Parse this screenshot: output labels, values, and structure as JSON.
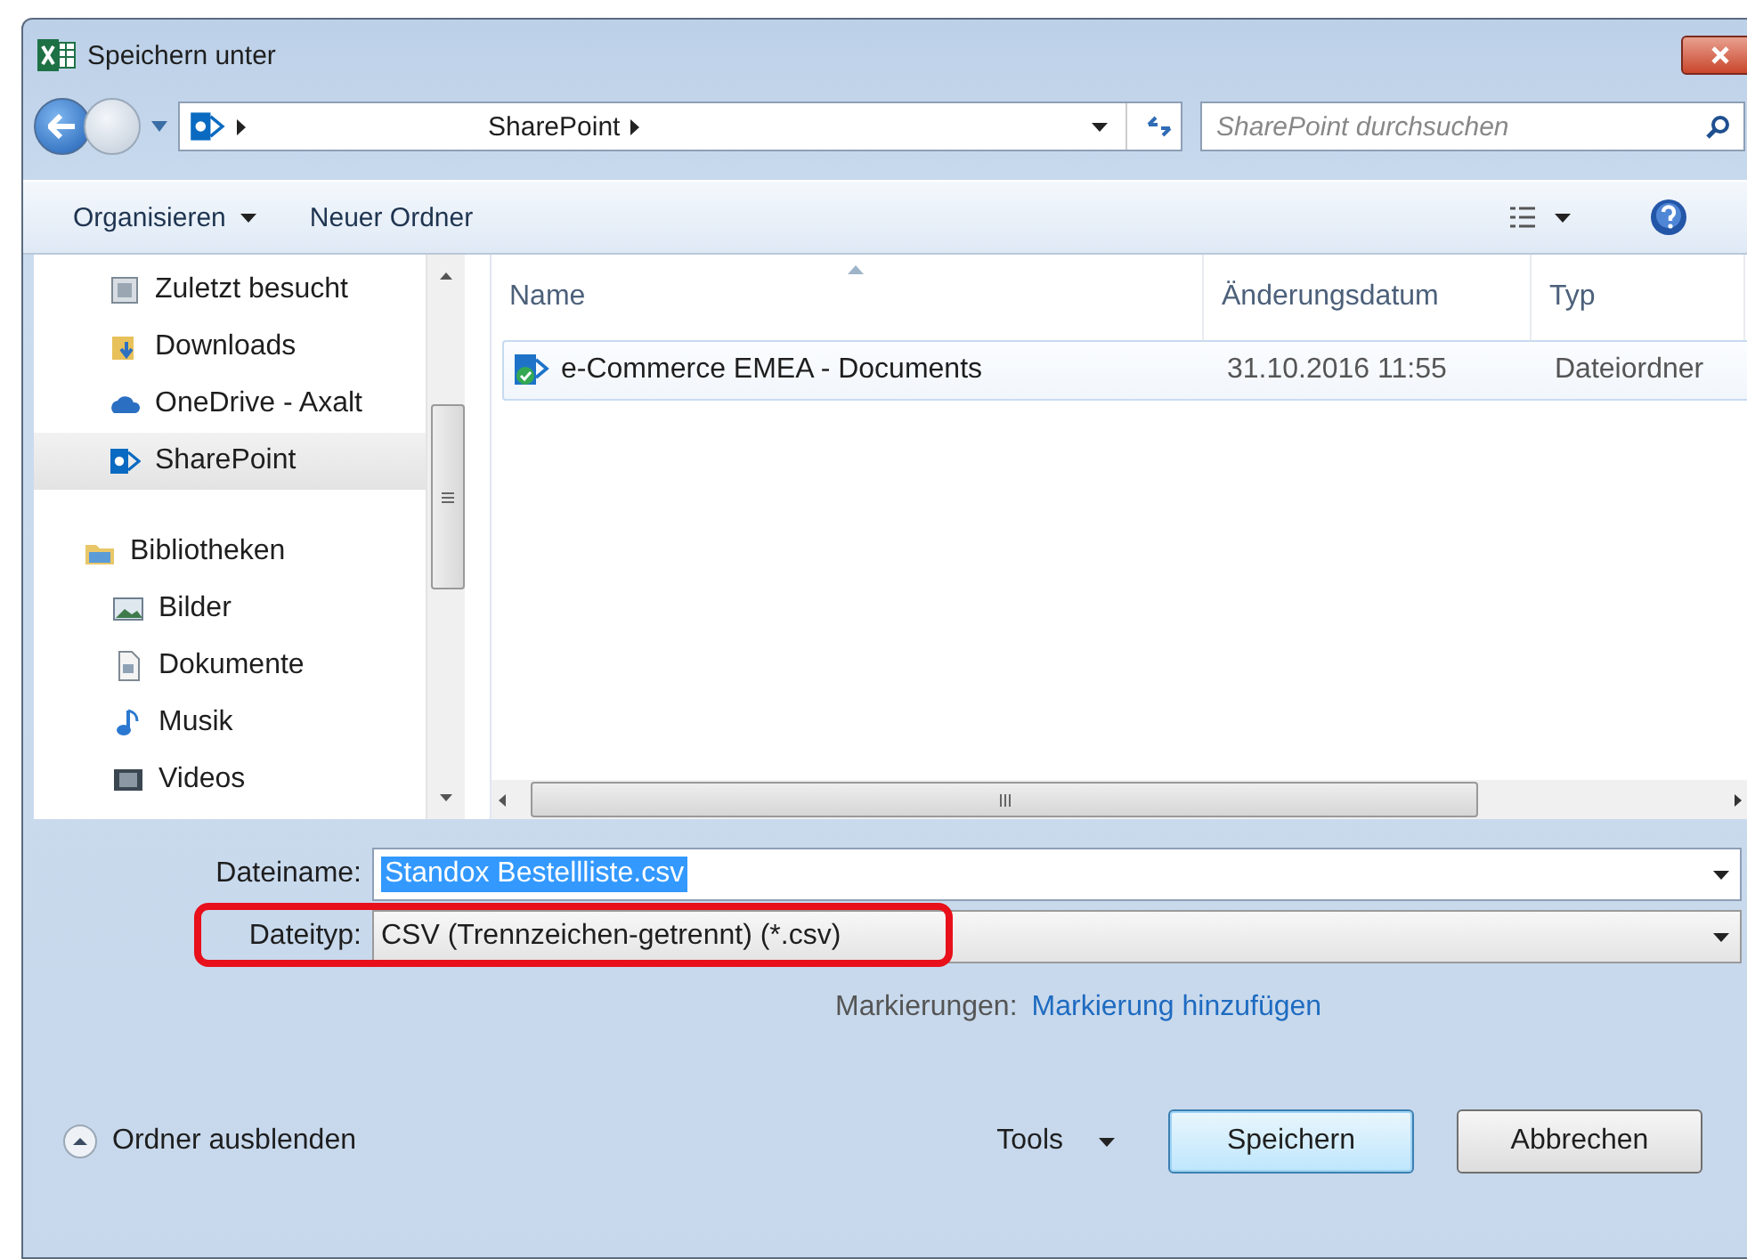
{
  "window": {
    "title": "Speichern unter"
  },
  "navigation": {
    "back_enabled": true,
    "forward_enabled": false,
    "path": "SharePoint",
    "search": {
      "placeholder": "SharePoint durchsuchen"
    }
  },
  "toolbar": {
    "items": [
      {
        "label": "Organisieren",
        "dropdown": true
      },
      {
        "label": "Neuer Ordner",
        "dropdown": false
      }
    ]
  },
  "sidebar": {
    "items": [
      {
        "label": "Zuletzt besucht",
        "kind": "recent",
        "selected": false
      },
      {
        "label": "Downloads",
        "kind": "downloads",
        "selected": false
      },
      {
        "label": "OneDrive - Axalt",
        "kind": "cloud",
        "selected": false
      },
      {
        "label": "SharePoint",
        "kind": "sharepoint",
        "selected": true
      },
      {
        "label": "Bibliotheken",
        "kind": "library",
        "selected": false,
        "children": [
          {
            "label": "Bilder",
            "kind": "pictures",
            "selected": false
          },
          {
            "label": "Dokumente",
            "kind": "documents",
            "selected": false
          },
          {
            "label": "Musik",
            "kind": "music",
            "selected": false
          },
          {
            "label": "Videos",
            "kind": "videos",
            "selected": false
          }
        ]
      }
    ]
  },
  "table": {
    "columns": [
      {
        "label": "Name",
        "sorted": true
      },
      {
        "label": "Änderungsdatum",
        "sorted": false
      },
      {
        "label": "Typ",
        "sorted": false
      }
    ],
    "rows": [
      {
        "cells": [
          "e-Commerce EMEA - Documents",
          "31.10.2016 11:55",
          "Dateiordner"
        ],
        "focused": true
      }
    ]
  },
  "form": {
    "filename": {
      "label": "Dateiname:",
      "value": "Standox Bestellliste.csv",
      "value_selected": true
    },
    "filetype": {
      "label": "Dateityp:",
      "value": "CSV (Trennzeichen-getrennt) (*.csv)",
      "highlighted": true
    },
    "tags": {
      "label": "Markierungen:",
      "link": "Markierung hinzufügen"
    }
  },
  "footer": {
    "toggle": "Ordner ausblenden",
    "tools": "Tools",
    "buttons": [
      {
        "label": "Speichern",
        "default": true
      },
      {
        "label": "Abbrechen",
        "default": false
      }
    ]
  }
}
